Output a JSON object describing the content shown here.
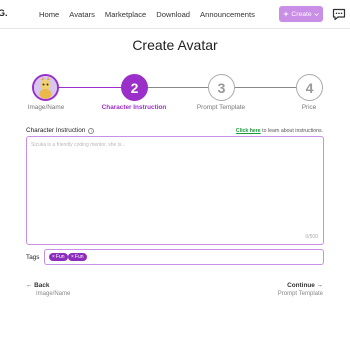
{
  "header": {
    "logo": "G.",
    "nav": [
      "Home",
      "Avatars",
      "Marketplace",
      "Download",
      "Announcements"
    ],
    "create_label": "Create",
    "icons": {
      "create": "sparkle-icon",
      "dropdown": "chevron-down-icon",
      "chat": "chat-bubble-icon"
    }
  },
  "page": {
    "title": "Create Avatar"
  },
  "stepper": {
    "steps": [
      {
        "label": "Image/Name",
        "number": "",
        "state": "done"
      },
      {
        "label": "Character Instruction",
        "number": "2",
        "state": "active"
      },
      {
        "label": "Prompt Template",
        "number": "3",
        "state": "inactive"
      },
      {
        "label": "Price",
        "number": "4",
        "state": "inactive"
      }
    ],
    "colors": {
      "active": "#9b2fc9",
      "inactive": "#aaaaaa"
    }
  },
  "instruction": {
    "label": "Character Instruction",
    "help_link": "Click here",
    "help_text": " to learn about instructions.",
    "placeholder": "Sizuka is a friendly coding mentor, she is...",
    "char_count": "0/500"
  },
  "tags": {
    "label": "Tags",
    "items": [
      "Fun",
      "Fun"
    ]
  },
  "footer": {
    "back_label": "Back",
    "back_sub": "Image/Name",
    "next_label": "Continue",
    "next_sub": "Prompt Template"
  }
}
